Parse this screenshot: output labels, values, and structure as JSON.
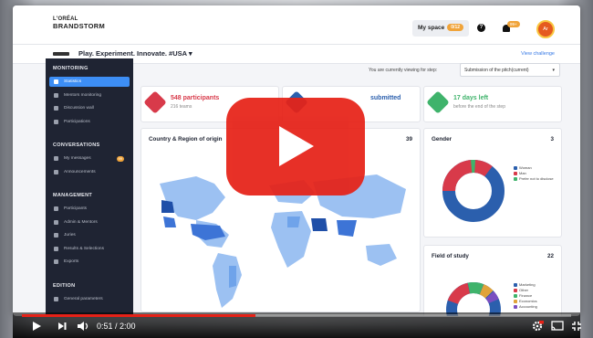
{
  "header": {
    "logo_top": "L'ORÉAL",
    "logo_main": "BRANDSTORM",
    "my_space_label": "My space",
    "my_space_badge": "0/12",
    "help_glyph": "?",
    "notif_badge": "99+",
    "avatar_initials": "Ar"
  },
  "subheader": {
    "challenge_title": "Play. Experiment. Innovate. #USA",
    "dropdown_glyph": "▾",
    "view_challenge": "View challenge"
  },
  "sidebar": {
    "sections": [
      {
        "title": "MONITORING",
        "items": [
          {
            "label": "Statistics",
            "icon": "chart-icon",
            "active": true
          },
          {
            "label": "Mentors monitoring",
            "icon": "user-icon"
          },
          {
            "label": "Discussion wall",
            "icon": "chat-icon"
          },
          {
            "label": "Participations",
            "icon": "doc-icon"
          }
        ]
      },
      {
        "title": "CONVERSATIONS",
        "items": [
          {
            "label": "My messages",
            "icon": "message-icon",
            "badge": "99"
          },
          {
            "label": "Announcements",
            "icon": "megaphone-icon"
          }
        ]
      },
      {
        "title": "MANAGEMENT",
        "items": [
          {
            "label": "Participants",
            "icon": "user-icon"
          },
          {
            "label": "Admin & Mentors",
            "icon": "users-icon"
          },
          {
            "label": "Juries",
            "icon": "gavel-icon"
          },
          {
            "label": "Results & Selections",
            "icon": "trophy-icon"
          },
          {
            "label": "Exports",
            "icon": "export-icon"
          }
        ]
      },
      {
        "title": "EDITION",
        "items": [
          {
            "label": "General parameters",
            "icon": "gear-icon"
          }
        ]
      }
    ]
  },
  "main": {
    "viewing_label": "You are currently viewing for step:",
    "step_select_value": "Submission of the pitch(current)",
    "stats": [
      {
        "main": "548 participants",
        "sub": "216 teams",
        "color": "#d83a4a"
      },
      {
        "main": "submitted",
        "sub": "",
        "color": "#2b5fad"
      },
      {
        "main": "17 days left",
        "sub": "before the end of the step",
        "color": "#3fb36b"
      }
    ],
    "map_card": {
      "title": "Country & Region of origin",
      "count": "39"
    },
    "gender_card": {
      "title": "Gender",
      "count": "3",
      "legend": [
        {
          "label": "Woman",
          "color": "#2b5fad"
        },
        {
          "label": "Man",
          "color": "#d83a4a"
        },
        {
          "label": "Prefer not to disclose",
          "color": "#3fb36b"
        }
      ]
    },
    "study_card": {
      "title": "Field of study",
      "count": "22",
      "legend": [
        {
          "label": "Marketing",
          "color": "#2b5fad"
        },
        {
          "label": "Other",
          "color": "#d83a4a"
        },
        {
          "label": "Finance",
          "color": "#3fb36b"
        },
        {
          "label": "Economics",
          "color": "#e0a33a"
        },
        {
          "label": "Accounting",
          "color": "#7a4fc0"
        }
      ]
    }
  },
  "player": {
    "time": "0:51 / 2:00",
    "progress_fraction": 0.425
  },
  "colors": {
    "accent": "#3d8ef5",
    "sidebar_bg": "#1f2433",
    "youtube_red": "#e62117"
  }
}
